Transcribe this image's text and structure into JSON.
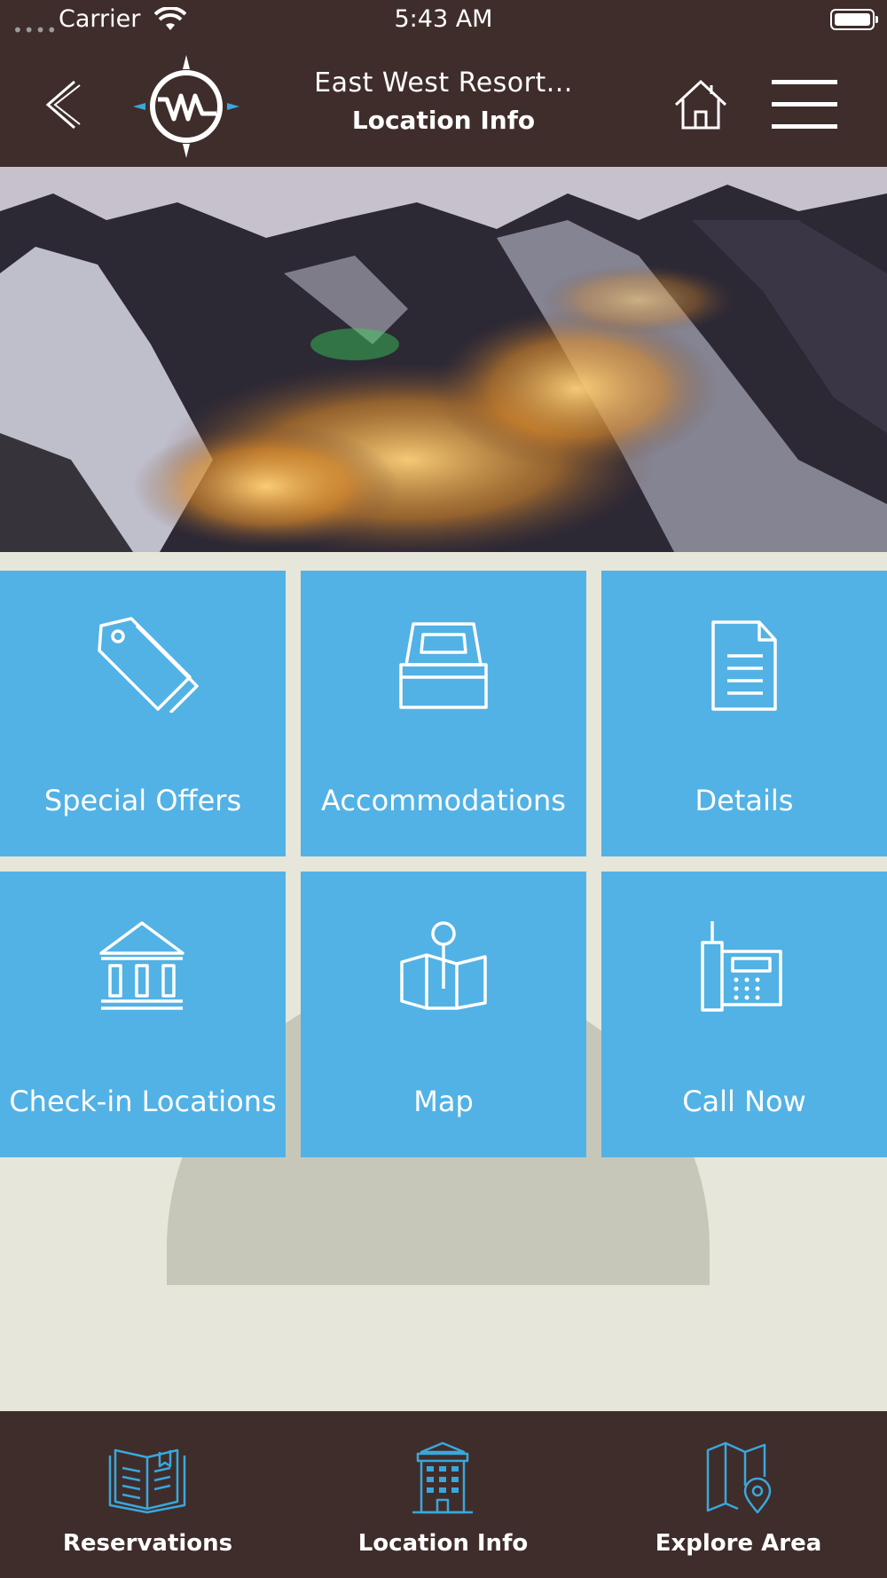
{
  "status_bar": {
    "signal": "••••",
    "carrier": "Carrier",
    "time": "5:43 AM"
  },
  "header": {
    "title": "East West Resort...",
    "subtitle": "Location Info"
  },
  "tiles": [
    {
      "label": "Special Offers",
      "icon": "tag-icon"
    },
    {
      "label": "Accommodations",
      "icon": "bed-icon"
    },
    {
      "label": "Details",
      "icon": "document-icon"
    },
    {
      "label": "Check-in Locations",
      "icon": "building-columns-icon"
    },
    {
      "label": "Map",
      "icon": "map-pin-icon"
    },
    {
      "label": "Call Now",
      "icon": "phone-icon"
    }
  ],
  "tab_bar": {
    "items": [
      {
        "label": "Reservations",
        "icon": "open-book-icon"
      },
      {
        "label": "Location Info",
        "icon": "hotel-building-icon"
      },
      {
        "label": "Explore Area",
        "icon": "map-location-icon"
      }
    ]
  },
  "colors": {
    "header_bg": "#3f2d2b",
    "tile_bg": "#52b2e5",
    "page_bg": "#e6e6da",
    "tab_icon": "#3aa7dc"
  }
}
